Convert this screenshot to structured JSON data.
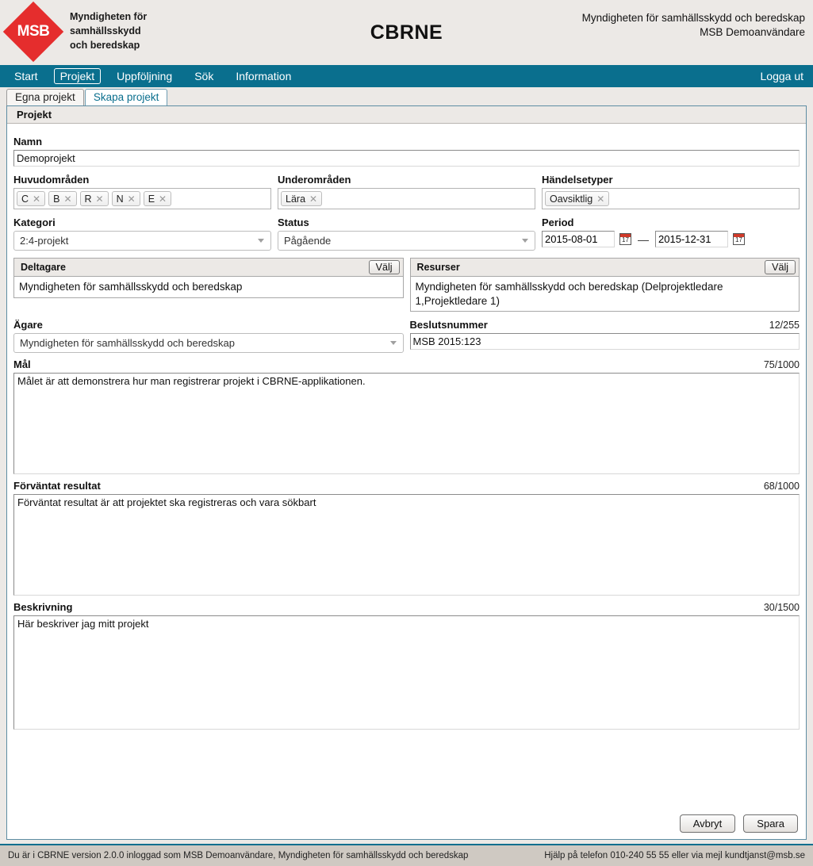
{
  "header": {
    "logo_text": "MSB",
    "logo_words": "Myndigheten för\nsamhällsskydd\noch beredskap",
    "logo_line1": "Myndigheten för",
    "logo_line2": "samhällsskydd",
    "logo_line3": "och beredskap",
    "app_title": "CBRNE",
    "org_name": "Myndigheten för samhällsskydd och beredskap",
    "user_name": "MSB Demoanvändare",
    "accent_color": "#0a6f8e",
    "brand_color": "#e52d2d"
  },
  "nav": {
    "items": [
      {
        "label": "Start",
        "active": false
      },
      {
        "label": "Projekt",
        "active": true
      },
      {
        "label": "Uppföljning",
        "active": false
      },
      {
        "label": "Sök",
        "active": false
      },
      {
        "label": "Information",
        "active": false
      }
    ],
    "logout_label": "Logga ut"
  },
  "tabs": [
    {
      "label": "Egna projekt",
      "active": false
    },
    {
      "label": "Skapa projekt",
      "active": true
    }
  ],
  "panel": {
    "title": "Projekt"
  },
  "form": {
    "namn": {
      "label": "Namn",
      "value": "Demoprojekt",
      "placeholder": ""
    },
    "huvudomraden": {
      "label": "Huvudområden",
      "tags": [
        "C",
        "B",
        "R",
        "N",
        "E"
      ],
      "remove_glyph": "✕"
    },
    "underomraden": {
      "label": "Underområden",
      "tags": [
        "Lära"
      ],
      "remove_glyph": "✕"
    },
    "handelsetyper": {
      "label": "Händelsetyper",
      "tags": [
        "Oavsiktlig"
      ],
      "remove_glyph": "✕"
    },
    "kategori": {
      "label": "Kategori",
      "value": "2:4-projekt"
    },
    "status": {
      "label": "Status",
      "value": "Pågående"
    },
    "period": {
      "label": "Period",
      "from": "2015-08-01",
      "to": "2015-12-31",
      "separator": "—",
      "calendar_day": "17"
    },
    "deltagare": {
      "label": "Deltagare",
      "button_label": "Välj",
      "value": "Myndigheten för samhällsskydd och beredskap"
    },
    "resurser": {
      "label": "Resurser",
      "button_label": "Välj",
      "value": "Myndigheten för samhällsskydd och beredskap (Delprojektledare 1,Projektledare 1)"
    },
    "agare": {
      "label": "Ägare",
      "value": "Myndigheten för samhällsskydd och beredskap"
    },
    "beslutsnummer": {
      "label": "Beslutsnummer",
      "counter": "12/255",
      "value": "MSB 2015:123"
    },
    "mal": {
      "label": "Mål",
      "counter": "75/1000",
      "value": "Målet är att demonstrera hur man registrerar projekt i CBRNE-applikationen."
    },
    "forvantat_resultat": {
      "label": "Förväntat resultat",
      "counter": "68/1000",
      "value": "Förväntat resultat är att projektet ska registreras och vara sökbart"
    },
    "beskrivning": {
      "label": "Beskrivning",
      "counter": "30/1500",
      "value": "Här beskriver jag mitt projekt"
    },
    "actions": {
      "cancel_label": "Avbryt",
      "save_label": "Spara"
    }
  },
  "footer": {
    "left": "Du är i CBRNE version 2.0.0 inloggad som MSB Demoanvändare, Myndigheten för samhällsskydd och beredskap",
    "right": "Hjälp på telefon 010-240 55 55 eller via mejl kundtjanst@msb.se"
  }
}
